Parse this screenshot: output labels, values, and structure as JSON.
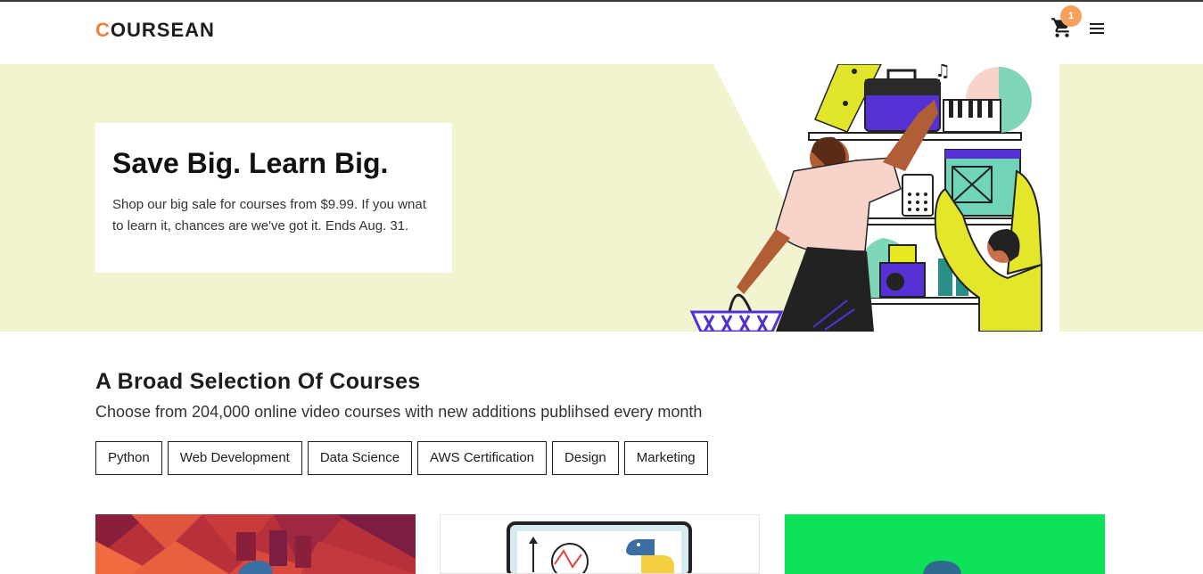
{
  "header": {
    "logo_first": "C",
    "logo_rest": "OURSEAN",
    "cart_count": "1",
    "cart_icon": "cart-icon",
    "menu_icon": "hamburger-menu-icon"
  },
  "hero": {
    "title": "Save Big. Learn Big.",
    "text": "Shop our big sale for courses from $9.99. If you wnat to learn it, chances are we've got it. Ends Aug. 31."
  },
  "courses_section": {
    "title": "A Broad Selection Of Courses",
    "subtitle": "Choose from 204,000 online video courses with new additions publihsed every month",
    "categories": [
      "Python",
      "Web Development",
      "Data Science",
      "AWS Certification",
      "Design",
      "Marketing"
    ]
  },
  "colors": {
    "accent": "#f5803e",
    "badge": "#f5a15b",
    "hero_bg": "#f2f3cf",
    "text_dark": "#1c1d1f"
  }
}
